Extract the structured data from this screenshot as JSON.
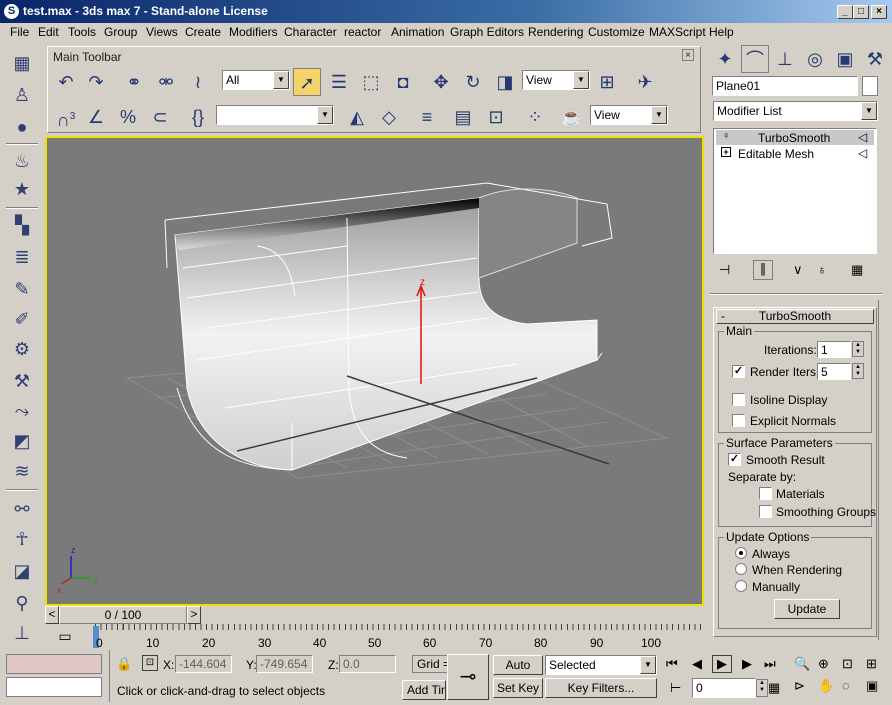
{
  "window": {
    "title": "test.max - 3ds max 7 - Stand-alone License",
    "minimize_label": "_",
    "maximize_label": "□",
    "close_label": "×"
  },
  "menu": [
    "File",
    "Edit",
    "Tools",
    "Group",
    "Views",
    "Create",
    "Modifiers",
    "Character",
    "reactor",
    "Animation",
    "Graph Editors",
    "Rendering",
    "Customize",
    "MAXScript",
    "Help"
  ],
  "toolbar": {
    "title": "Main Toolbar",
    "close_label": "×",
    "selection_filter": "All",
    "ref_coord_1": "View",
    "named_selection": "",
    "ref_coord_2": "View",
    "snap_label": "3"
  },
  "viewport": {
    "axis_z": "z",
    "axis_x": "x",
    "axis_y": "y"
  },
  "time": {
    "slider": "0 / 100",
    "prev_label": "<",
    "next_label": ">",
    "ticks": [
      "0",
      "10",
      "20",
      "30",
      "40",
      "50",
      "60",
      "70",
      "80",
      "90",
      "100"
    ]
  },
  "command_panel": {
    "object_name": "Plane01",
    "modifier_list": "Modifier List",
    "stack": [
      {
        "label": "TurboSmooth",
        "selected": true
      },
      {
        "label": "Editable Mesh",
        "selected": false
      }
    ],
    "rollout_title": "TurboSmooth",
    "rollout_toggle": "-",
    "main": {
      "title": "Main",
      "iterations_label": "Iterations:",
      "iterations": "1",
      "render_iters_label": "Render Iters:",
      "render_iters": "5",
      "render_iters_checked": true,
      "isoline_label": "Isoline Display",
      "isoline_checked": false,
      "explicit_normals_label": "Explicit Normals",
      "explicit_normals_checked": false
    },
    "surface": {
      "title": "Surface Parameters",
      "smooth_result_label": "Smooth Result",
      "smooth_result_checked": true,
      "separate_by_label": "Separate by:",
      "materials_label": "Materials",
      "materials_checked": false,
      "smoothing_groups_label": "Smoothing Groups",
      "smoothing_groups_checked": false
    },
    "update": {
      "title": "Update Options",
      "options": [
        "Always",
        "When Rendering",
        "Manually"
      ],
      "selected": "Always",
      "update_button": "Update"
    }
  },
  "status": {
    "x_label": "X:",
    "x_value": "-144.604",
    "y_label": "Y:",
    "y_value": "-749.654",
    "z_label": "Z:",
    "z_value": "0.0",
    "grid_label": "Grid =",
    "prompt": "Click or click-and-drag to select objects",
    "add_time_tag": "Add Tim",
    "auto_key": "Auto Key",
    "set_key": "Set Key",
    "key_filter": "Selected",
    "key_filters_button": "Key Filters...",
    "frame_value": "0"
  },
  "colors": {
    "title_start": "#0a246a",
    "title_end": "#a6caf0",
    "viewport_bg": "#7a7a7a",
    "active_border": "#f0e000",
    "stack_selected": "#c8c8c8"
  }
}
